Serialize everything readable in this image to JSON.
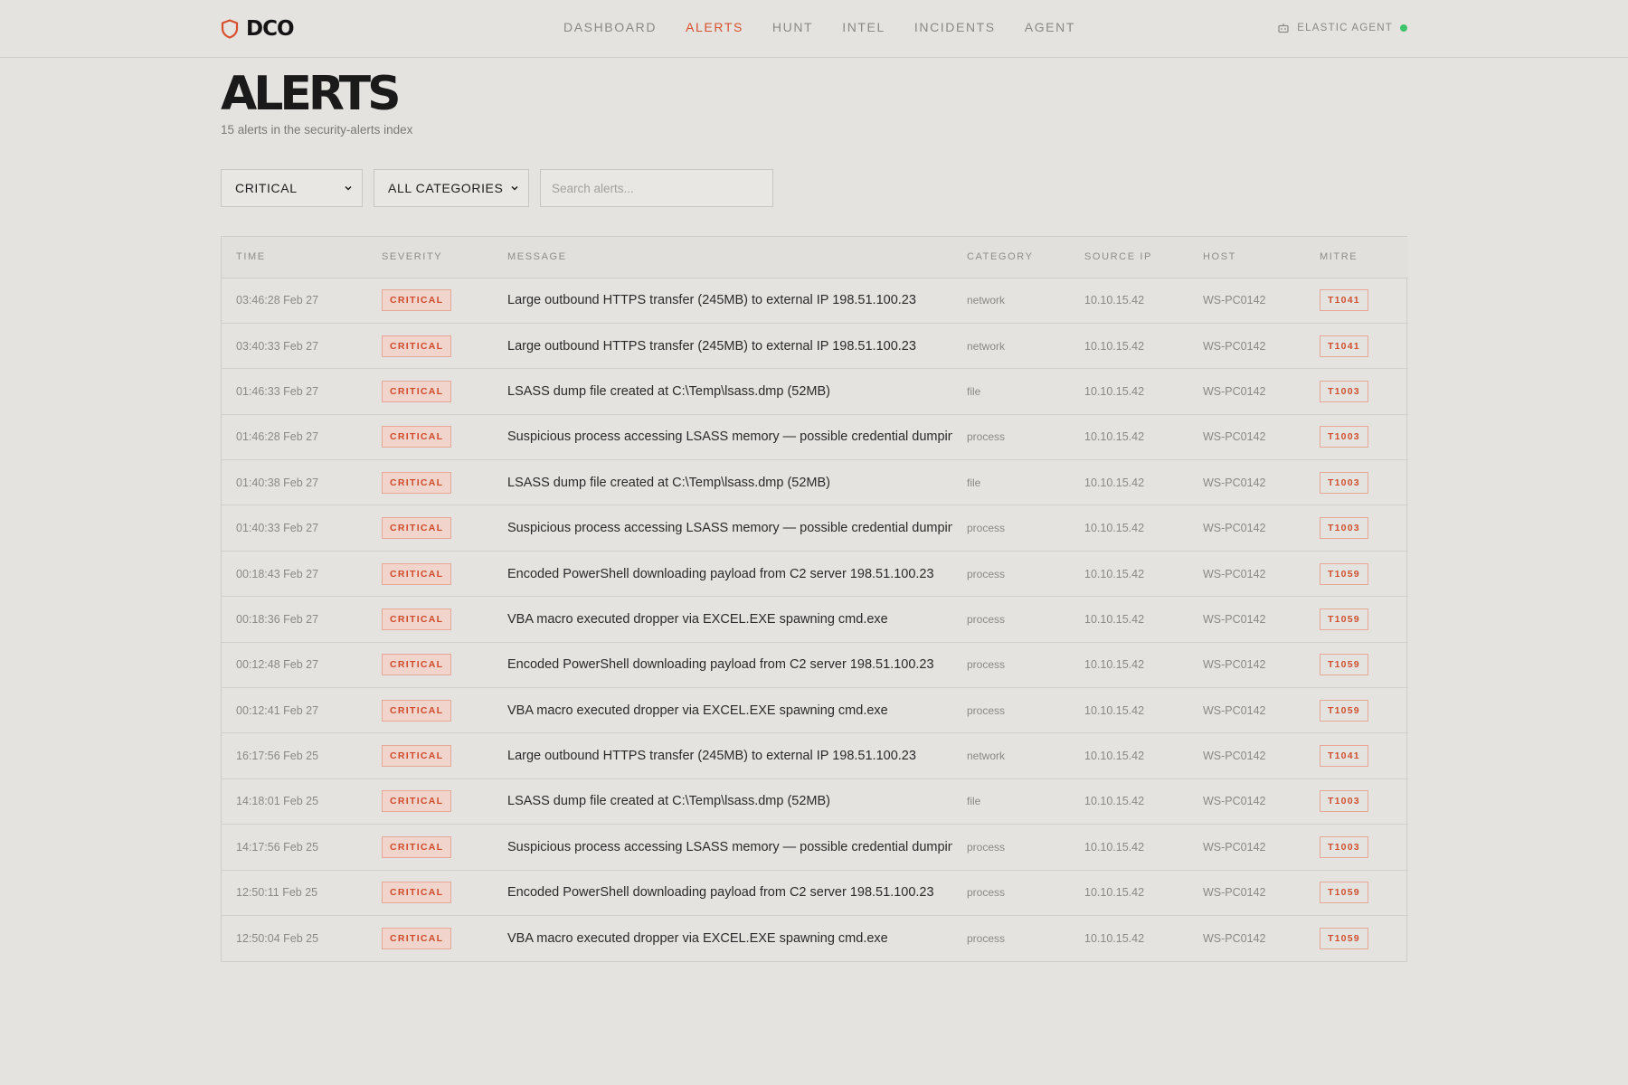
{
  "nav": {
    "brand": "DCO",
    "links": [
      {
        "label": "DASHBOARD",
        "active": false
      },
      {
        "label": "ALERTS",
        "active": true
      },
      {
        "label": "HUNT",
        "active": false
      },
      {
        "label": "INTEL",
        "active": false
      },
      {
        "label": "INCIDENTS",
        "active": false
      },
      {
        "label": "AGENT",
        "active": false
      }
    ],
    "agent_label": "ELASTIC AGENT",
    "agent_status_color": "#3ec46d"
  },
  "header": {
    "title": "ALERTS",
    "subtitle": "15 alerts in the security-alerts index"
  },
  "filters": {
    "severity": "CRITICAL",
    "category": "ALL CATEGORIES",
    "search_placeholder": "Search alerts..."
  },
  "table": {
    "columns": [
      "TIME",
      "SEVERITY",
      "MESSAGE",
      "CATEGORY",
      "SOURCE IP",
      "HOST",
      "MITRE"
    ],
    "rows": [
      {
        "time": "03:46:28 Feb 27",
        "severity": "CRITICAL",
        "message": "Large outbound HTTPS transfer (245MB) to external IP 198.51.100.23",
        "category": "network",
        "source_ip": "10.10.15.42",
        "host": "WS-PC0142",
        "mitre": "T1041"
      },
      {
        "time": "03:40:33 Feb 27",
        "severity": "CRITICAL",
        "message": "Large outbound HTTPS transfer (245MB) to external IP 198.51.100.23",
        "category": "network",
        "source_ip": "10.10.15.42",
        "host": "WS-PC0142",
        "mitre": "T1041"
      },
      {
        "time": "01:46:33 Feb 27",
        "severity": "CRITICAL",
        "message": "LSASS dump file created at C:\\Temp\\lsass.dmp (52MB)",
        "category": "file",
        "source_ip": "10.10.15.42",
        "host": "WS-PC0142",
        "mitre": "T1003"
      },
      {
        "time": "01:46:28 Feb 27",
        "severity": "CRITICAL",
        "message": "Suspicious process accessing LSASS memory — possible credential dumping",
        "category": "process",
        "source_ip": "10.10.15.42",
        "host": "WS-PC0142",
        "mitre": "T1003"
      },
      {
        "time": "01:40:38 Feb 27",
        "severity": "CRITICAL",
        "message": "LSASS dump file created at C:\\Temp\\lsass.dmp (52MB)",
        "category": "file",
        "source_ip": "10.10.15.42",
        "host": "WS-PC0142",
        "mitre": "T1003"
      },
      {
        "time": "01:40:33 Feb 27",
        "severity": "CRITICAL",
        "message": "Suspicious process accessing LSASS memory — possible credential dumping",
        "category": "process",
        "source_ip": "10.10.15.42",
        "host": "WS-PC0142",
        "mitre": "T1003"
      },
      {
        "time": "00:18:43 Feb 27",
        "severity": "CRITICAL",
        "message": "Encoded PowerShell downloading payload from C2 server 198.51.100.23",
        "category": "process",
        "source_ip": "10.10.15.42",
        "host": "WS-PC0142",
        "mitre": "T1059"
      },
      {
        "time": "00:18:36 Feb 27",
        "severity": "CRITICAL",
        "message": "VBA macro executed dropper via EXCEL.EXE spawning cmd.exe",
        "category": "process",
        "source_ip": "10.10.15.42",
        "host": "WS-PC0142",
        "mitre": "T1059"
      },
      {
        "time": "00:12:48 Feb 27",
        "severity": "CRITICAL",
        "message": "Encoded PowerShell downloading payload from C2 server 198.51.100.23",
        "category": "process",
        "source_ip": "10.10.15.42",
        "host": "WS-PC0142",
        "mitre": "T1059"
      },
      {
        "time": "00:12:41 Feb 27",
        "severity": "CRITICAL",
        "message": "VBA macro executed dropper via EXCEL.EXE spawning cmd.exe",
        "category": "process",
        "source_ip": "10.10.15.42",
        "host": "WS-PC0142",
        "mitre": "T1059"
      },
      {
        "time": "16:17:56 Feb 25",
        "severity": "CRITICAL",
        "message": "Large outbound HTTPS transfer (245MB) to external IP 198.51.100.23",
        "category": "network",
        "source_ip": "10.10.15.42",
        "host": "WS-PC0142",
        "mitre": "T1041"
      },
      {
        "time": "14:18:01 Feb 25",
        "severity": "CRITICAL",
        "message": "LSASS dump file created at C:\\Temp\\lsass.dmp (52MB)",
        "category": "file",
        "source_ip": "10.10.15.42",
        "host": "WS-PC0142",
        "mitre": "T1003"
      },
      {
        "time": "14:17:56 Feb 25",
        "severity": "CRITICAL",
        "message": "Suspicious process accessing LSASS memory — possible credential dumping",
        "category": "process",
        "source_ip": "10.10.15.42",
        "host": "WS-PC0142",
        "mitre": "T1003"
      },
      {
        "time": "12:50:11 Feb 25",
        "severity": "CRITICAL",
        "message": "Encoded PowerShell downloading payload from C2 server 198.51.100.23",
        "category": "process",
        "source_ip": "10.10.15.42",
        "host": "WS-PC0142",
        "mitre": "T1059"
      },
      {
        "time": "12:50:04 Feb 25",
        "severity": "CRITICAL",
        "message": "VBA macro executed dropper via EXCEL.EXE spawning cmd.exe",
        "category": "process",
        "source_ip": "10.10.15.42",
        "host": "WS-PC0142",
        "mitre": "T1059"
      }
    ]
  },
  "colors": {
    "accent": "#d9502f",
    "background": "#e4e3df"
  },
  "icons": {
    "brand": "shield-icon",
    "agent": "robot-icon",
    "select": "chevron-down-icon"
  }
}
